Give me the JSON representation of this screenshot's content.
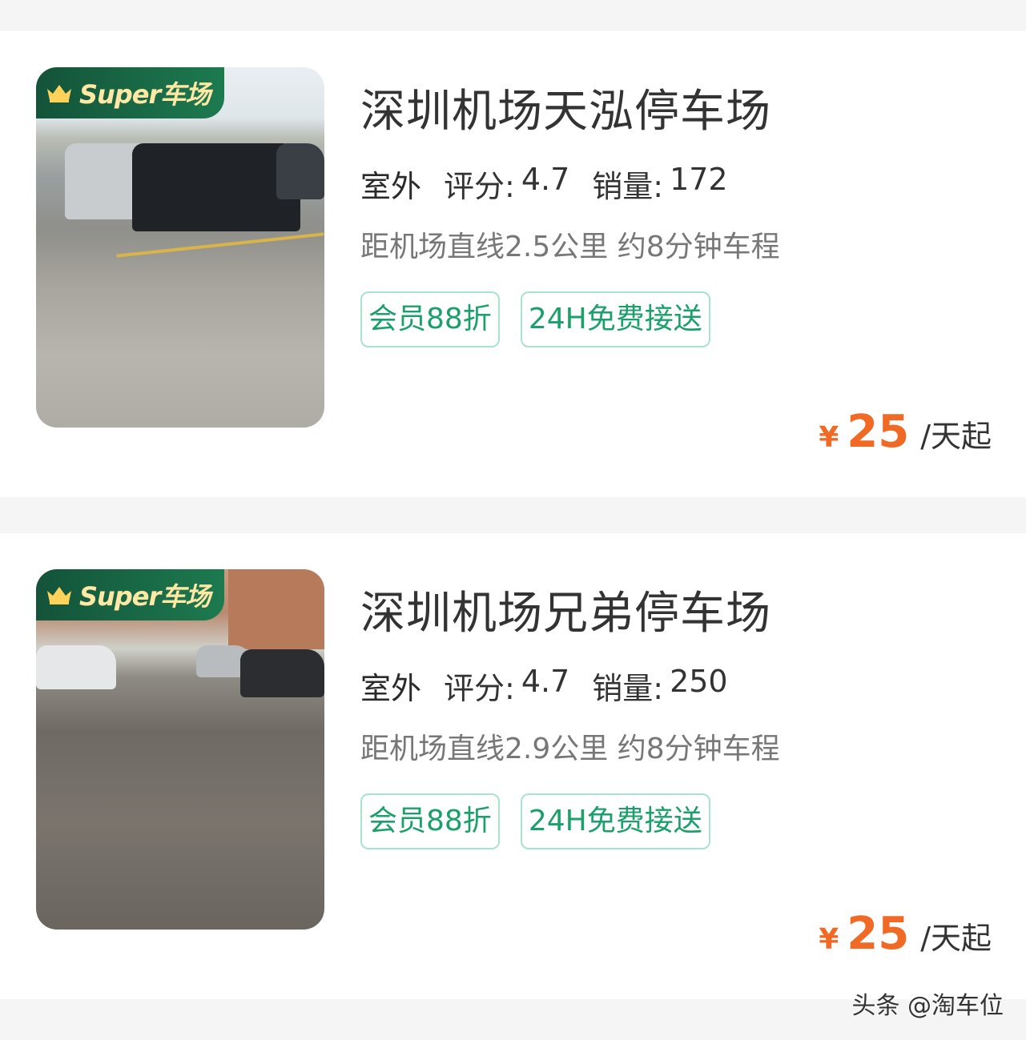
{
  "badge_label": "Super车场",
  "listings": [
    {
      "name": "深圳机场天泓停车场",
      "type": "室外",
      "rating_label": "评分:",
      "rating": "4.7",
      "sales_label": "销量:",
      "sales": "172",
      "distance": "距机场直线2.5公里 约8分钟车程",
      "tags": [
        "会员88折",
        "24H免费接送"
      ],
      "currency": "¥",
      "price": "25",
      "price_unit": "/天起"
    },
    {
      "name": "深圳机场兄弟停车场",
      "type": "室外",
      "rating_label": "评分:",
      "rating": "4.7",
      "sales_label": "销量:",
      "sales": "250",
      "distance": "距机场直线2.9公里 约8分钟车程",
      "tags": [
        "会员88折",
        "24H免费接送"
      ],
      "currency": "¥",
      "price": "25",
      "price_unit": "/天起"
    }
  ],
  "watermark": "头条 @淘车位",
  "colors": {
    "accent_green": "#1ba06b",
    "price_orange": "#f06a26",
    "badge_green": "#13533a"
  }
}
